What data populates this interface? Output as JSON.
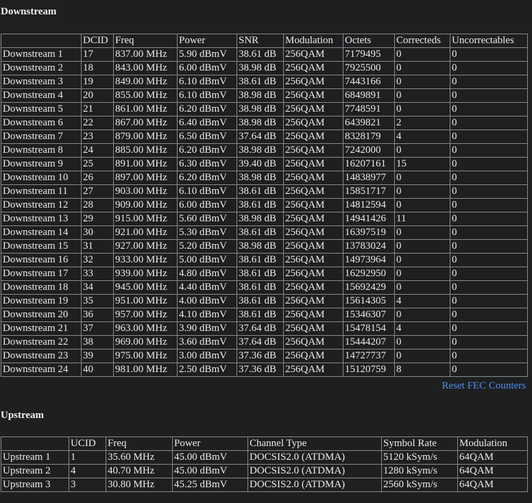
{
  "downstream": {
    "title": "Downstream",
    "headers": [
      "",
      "DCID",
      "Freq",
      "Power",
      "SNR",
      "Modulation",
      "Octets",
      "Correcteds",
      "Uncorrectables"
    ],
    "rows": [
      [
        "Downstream 1",
        "17",
        "837.00 MHz",
        "5.90 dBmV",
        "38.61 dB",
        "256QAM",
        "7179495",
        "0",
        "0"
      ],
      [
        "Downstream 2",
        "18",
        "843.00 MHz",
        "6.00 dBmV",
        "38.98 dB",
        "256QAM",
        "7925500",
        "0",
        "0"
      ],
      [
        "Downstream 3",
        "19",
        "849.00 MHz",
        "6.10 dBmV",
        "38.61 dB",
        "256QAM",
        "7443166",
        "0",
        "0"
      ],
      [
        "Downstream 4",
        "20",
        "855.00 MHz",
        "6.10 dBmV",
        "38.98 dB",
        "256QAM",
        "6849891",
        "0",
        "0"
      ],
      [
        "Downstream 5",
        "21",
        "861.00 MHz",
        "6.20 dBmV",
        "38.98 dB",
        "256QAM",
        "7748591",
        "0",
        "0"
      ],
      [
        "Downstream 6",
        "22",
        "867.00 MHz",
        "6.40 dBmV",
        "38.98 dB",
        "256QAM",
        "6439821",
        "2",
        "0"
      ],
      [
        "Downstream 7",
        "23",
        "879.00 MHz",
        "6.50 dBmV",
        "37.64 dB",
        "256QAM",
        "8328179",
        "4",
        "0"
      ],
      [
        "Downstream 8",
        "24",
        "885.00 MHz",
        "6.20 dBmV",
        "38.98 dB",
        "256QAM",
        "7242000",
        "0",
        "0"
      ],
      [
        "Downstream 9",
        "25",
        "891.00 MHz",
        "6.30 dBmV",
        "39.40 dB",
        "256QAM",
        "16207161",
        "15",
        "0"
      ],
      [
        "Downstream 10",
        "26",
        "897.00 MHz",
        "6.20 dBmV",
        "38.98 dB",
        "256QAM",
        "14838977",
        "0",
        "0"
      ],
      [
        "Downstream 11",
        "27",
        "903.00 MHz",
        "6.10 dBmV",
        "38.61 dB",
        "256QAM",
        "15851717",
        "0",
        "0"
      ],
      [
        "Downstream 12",
        "28",
        "909.00 MHz",
        "6.00 dBmV",
        "38.61 dB",
        "256QAM",
        "14812594",
        "0",
        "0"
      ],
      [
        "Downstream 13",
        "29",
        "915.00 MHz",
        "5.60 dBmV",
        "38.98 dB",
        "256QAM",
        "14941426",
        "11",
        "0"
      ],
      [
        "Downstream 14",
        "30",
        "921.00 MHz",
        "5.30 dBmV",
        "38.61 dB",
        "256QAM",
        "16397519",
        "0",
        "0"
      ],
      [
        "Downstream 15",
        "31",
        "927.00 MHz",
        "5.20 dBmV",
        "38.98 dB",
        "256QAM",
        "13783024",
        "0",
        "0"
      ],
      [
        "Downstream 16",
        "32",
        "933.00 MHz",
        "5.00 dBmV",
        "38.61 dB",
        "256QAM",
        "14973964",
        "0",
        "0"
      ],
      [
        "Downstream 17",
        "33",
        "939.00 MHz",
        "4.80 dBmV",
        "38.61 dB",
        "256QAM",
        "16292950",
        "0",
        "0"
      ],
      [
        "Downstream 18",
        "34",
        "945.00 MHz",
        "4.40 dBmV",
        "38.61 dB",
        "256QAM",
        "15692429",
        "0",
        "0"
      ],
      [
        "Downstream 19",
        "35",
        "951.00 MHz",
        "4.00 dBmV",
        "38.61 dB",
        "256QAM",
        "15614305",
        "4",
        "0"
      ],
      [
        "Downstream 20",
        "36",
        "957.00 MHz",
        "4.10 dBmV",
        "38.61 dB",
        "256QAM",
        "15346307",
        "0",
        "0"
      ],
      [
        "Downstream 21",
        "37",
        "963.00 MHz",
        "3.90 dBmV",
        "37.64 dB",
        "256QAM",
        "15478154",
        "4",
        "0"
      ],
      [
        "Downstream 22",
        "38",
        "969.00 MHz",
        "3.60 dBmV",
        "37.64 dB",
        "256QAM",
        "15444207",
        "0",
        "0"
      ],
      [
        "Downstream 23",
        "39",
        "975.00 MHz",
        "3.00 dBmV",
        "37.36 dB",
        "256QAM",
        "14727737",
        "0",
        "0"
      ],
      [
        "Downstream 24",
        "40",
        "981.00 MHz",
        "2.50 dBmV",
        "37.36 dB",
        "256QAM",
        "15120759",
        "8",
        "0"
      ]
    ],
    "reset_link": "Reset FEC Counters"
  },
  "upstream": {
    "title": "Upstream",
    "headers": [
      "",
      "UCID",
      "Freq",
      "Power",
      "Channel Type",
      "Symbol Rate",
      "Modulation"
    ],
    "rows": [
      [
        "Upstream 1",
        "1",
        "35.60 MHz",
        "45.00 dBmV",
        "DOCSIS2.0 (ATDMA)",
        "5120 kSym/s",
        "64QAM"
      ],
      [
        "Upstream 2",
        "4",
        "40.70 MHz",
        "45.00 dBmV",
        "DOCSIS2.0 (ATDMA)",
        "1280 kSym/s",
        "64QAM"
      ],
      [
        "Upstream 3",
        "3",
        "30.80 MHz",
        "45.25 dBmV",
        "DOCSIS2.0 (ATDMA)",
        "2560 kSym/s",
        "64QAM"
      ]
    ]
  },
  "colors": {
    "background": "#1e1f21",
    "text": "#ececec",
    "border": "#8a8a8a",
    "link": "#4f8fe6"
  }
}
